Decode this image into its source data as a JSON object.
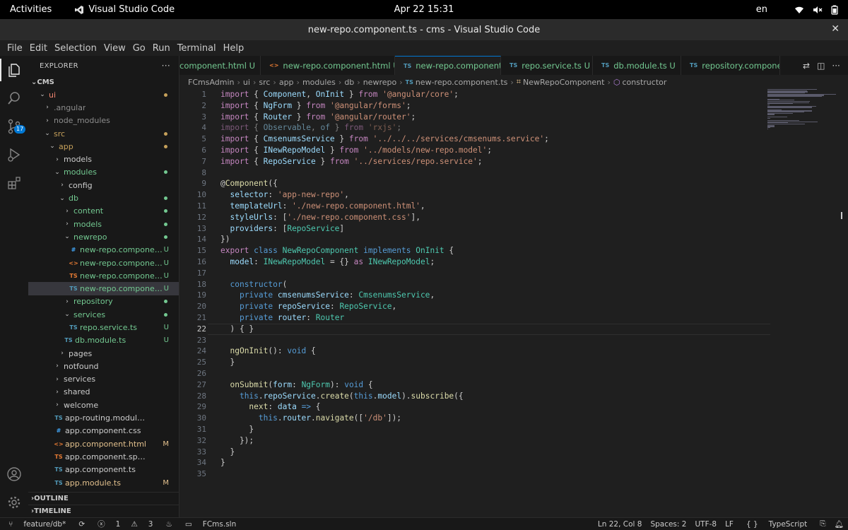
{
  "topbar": {
    "activities": "Activities",
    "app_name": "Visual Studio Code",
    "clock": "Apr 22  15:31",
    "lang": "en"
  },
  "window": {
    "title": "new-repo.component.ts - cms - Visual Studio Code"
  },
  "menu": [
    "File",
    "Edit",
    "Selection",
    "View",
    "Go",
    "Run",
    "Terminal",
    "Help"
  ],
  "activity_bar": {
    "scm_badge": "17"
  },
  "explorer": {
    "header": "EXPLORER",
    "more": "···",
    "root": "CMS",
    "rows": [
      {
        "label": "ui",
        "depth": 1,
        "kind": "folder-open",
        "color": "#f48771",
        "dot": "#c5a05a"
      },
      {
        "label": ".angular",
        "depth": 2,
        "kind": "folder",
        "color": "#8c8c8c"
      },
      {
        "label": "node_modules",
        "depth": 2,
        "kind": "folder",
        "color": "#8c8c8c"
      },
      {
        "label": "src",
        "depth": 2,
        "kind": "folder-open",
        "color": "#c5a05a",
        "dot": "#c5a05a"
      },
      {
        "label": "app",
        "depth": 3,
        "kind": "folder-open",
        "color": "#c5a05a",
        "dot": "#c5a05a"
      },
      {
        "label": "models",
        "depth": 4,
        "kind": "folder",
        "color": "#cccccc"
      },
      {
        "label": "modules",
        "depth": 4,
        "kind": "folder-open",
        "color": "#73c991",
        "dot": "#73c991"
      },
      {
        "label": "config",
        "depth": 5,
        "kind": "folder",
        "color": "#cccccc"
      },
      {
        "label": "db",
        "depth": 5,
        "kind": "folder-open",
        "color": "#73c991",
        "dot": "#73c991"
      },
      {
        "label": "content",
        "depth": 6,
        "kind": "folder",
        "color": "#73c991",
        "dot": "#73c991"
      },
      {
        "label": "models",
        "depth": 6,
        "kind": "folder",
        "color": "#73c991",
        "dot": "#73c991"
      },
      {
        "label": "newrepo",
        "depth": 6,
        "kind": "folder-open",
        "color": "#73c991",
        "dot": "#73c991"
      },
      {
        "label": "new-repo.componen...",
        "depth": 7,
        "kind": "file",
        "icon": "#",
        "icon_color": "#42a5f5",
        "color": "#73c991",
        "status": "U"
      },
      {
        "label": "new-repo.componen...",
        "depth": 7,
        "kind": "file",
        "icon": "<>",
        "icon_color": "#e37933",
        "color": "#73c991",
        "status": "U"
      },
      {
        "label": "new-repo.componen...",
        "depth": 7,
        "kind": "file",
        "icon": "TS",
        "icon_color": "#e37933",
        "color": "#73c991",
        "status": "U"
      },
      {
        "label": "new-repo.componen...",
        "depth": 7,
        "kind": "file",
        "icon": "TS",
        "icon_color": "#519aba",
        "color": "#73c991",
        "status": "U",
        "selected": true
      },
      {
        "label": "repository",
        "depth": 6,
        "kind": "folder",
        "color": "#73c991",
        "dot": "#73c991"
      },
      {
        "label": "services",
        "depth": 6,
        "kind": "folder-open",
        "color": "#73c991",
        "dot": "#73c991"
      },
      {
        "label": "repo.service.ts",
        "depth": 7,
        "kind": "file",
        "icon": "TS",
        "icon_color": "#519aba",
        "color": "#73c991",
        "status": "U"
      },
      {
        "label": "db.module.ts",
        "depth": 6,
        "kind": "file",
        "icon": "TS",
        "icon_color": "#519aba",
        "color": "#73c991",
        "status": "U"
      },
      {
        "label": "pages",
        "depth": 5,
        "kind": "folder",
        "color": "#cccccc"
      },
      {
        "label": "notfound",
        "depth": 4,
        "kind": "folder",
        "color": "#cccccc"
      },
      {
        "label": "services",
        "depth": 4,
        "kind": "folder",
        "color": "#cccccc"
      },
      {
        "label": "shared",
        "depth": 4,
        "kind": "folder",
        "color": "#cccccc"
      },
      {
        "label": "welcome",
        "depth": 4,
        "kind": "folder",
        "color": "#cccccc"
      },
      {
        "label": "app-routing.module.ts",
        "depth": 4,
        "kind": "file",
        "icon": "TS",
        "icon_color": "#519aba",
        "color": "#cccccc"
      },
      {
        "label": "app.component.css",
        "depth": 4,
        "kind": "file",
        "icon": "#",
        "icon_color": "#42a5f5",
        "color": "#cccccc"
      },
      {
        "label": "app.component.html",
        "depth": 4,
        "kind": "file",
        "icon": "<>",
        "icon_color": "#e37933",
        "color": "#e2c08d",
        "status": "M"
      },
      {
        "label": "app.component.spec.ts",
        "depth": 4,
        "kind": "file",
        "icon": "TS",
        "icon_color": "#e37933",
        "color": "#cccccc"
      },
      {
        "label": "app.component.ts",
        "depth": 4,
        "kind": "file",
        "icon": "TS",
        "icon_color": "#519aba",
        "color": "#cccccc"
      },
      {
        "label": "app.module.ts",
        "depth": 4,
        "kind": "file",
        "icon": "TS",
        "icon_color": "#519aba",
        "color": "#e2c08d",
        "status": "M"
      }
    ],
    "outline": "OUTLINE",
    "timeline": "TIMELINE"
  },
  "tabs": [
    {
      "label": "component.html",
      "status": "U",
      "icon": "",
      "icon_color": "#e37933"
    },
    {
      "label": "new-repo.component.html",
      "status": "U",
      "icon": "<>",
      "icon_color": "#e37933"
    },
    {
      "label": "new-repo.component.ts",
      "status": "U",
      "icon": "TS",
      "icon_color": "#519aba",
      "active": true
    },
    {
      "label": "repo.service.ts",
      "status": "U",
      "icon": "TS",
      "icon_color": "#519aba"
    },
    {
      "label": "db.module.ts",
      "status": "U",
      "icon": "TS",
      "icon_color": "#519aba"
    },
    {
      "label": "repository.componen",
      "status": "",
      "icon": "TS",
      "icon_color": "#519aba"
    }
  ],
  "breadcrumb": [
    "FCmsAdmin",
    "ui",
    "src",
    "app",
    "modules",
    "db",
    "newrepo",
    "new-repo.component.ts",
    "NewRepoComponent",
    "constructor"
  ],
  "editor": {
    "current_line": 22,
    "lines": [
      [
        [
          "k",
          "import"
        ],
        [
          "p",
          " { "
        ],
        [
          "v",
          "Component"
        ],
        [
          "p",
          ", "
        ],
        [
          "v",
          "OnInit"
        ],
        [
          "p",
          " } "
        ],
        [
          "k",
          "from"
        ],
        [
          "p",
          " "
        ],
        [
          "s",
          "'@angular/core'"
        ],
        [
          "p",
          ";"
        ]
      ],
      [
        [
          "k",
          "import"
        ],
        [
          "p",
          " { "
        ],
        [
          "v",
          "NgForm"
        ],
        [
          "p",
          " } "
        ],
        [
          "k",
          "from"
        ],
        [
          "p",
          " "
        ],
        [
          "s",
          "'@angular/forms'"
        ],
        [
          "p",
          ";"
        ]
      ],
      [
        [
          "k",
          "import"
        ],
        [
          "p",
          " { "
        ],
        [
          "v",
          "Router"
        ],
        [
          "p",
          " } "
        ],
        [
          "k",
          "from"
        ],
        [
          "p",
          " "
        ],
        [
          "s",
          "'@angular/router'"
        ],
        [
          "p",
          ";"
        ]
      ],
      [
        [
          "dk",
          "import"
        ],
        [
          "dp",
          " { "
        ],
        [
          "dv",
          "Observable"
        ],
        [
          "dp",
          ", "
        ],
        [
          "dv",
          "of"
        ],
        [
          "dp",
          " } "
        ],
        [
          "dk",
          "from"
        ],
        [
          "dp",
          " "
        ],
        [
          "ds",
          "'rxjs'"
        ],
        [
          "dp",
          ";"
        ]
      ],
      [
        [
          "k",
          "import"
        ],
        [
          "p",
          " { "
        ],
        [
          "v",
          "CmsenumsService"
        ],
        [
          "p",
          " } "
        ],
        [
          "k",
          "from"
        ],
        [
          "p",
          " "
        ],
        [
          "s",
          "'../../../services/cmsenums.service'"
        ],
        [
          "p",
          ";"
        ]
      ],
      [
        [
          "k",
          "import"
        ],
        [
          "p",
          " { "
        ],
        [
          "v",
          "INewRepoModel"
        ],
        [
          "p",
          " } "
        ],
        [
          "k",
          "from"
        ],
        [
          "p",
          " "
        ],
        [
          "s",
          "'../models/new-repo.model'"
        ],
        [
          "p",
          ";"
        ]
      ],
      [
        [
          "k",
          "import"
        ],
        [
          "p",
          " { "
        ],
        [
          "v",
          "RepoService"
        ],
        [
          "p",
          " } "
        ],
        [
          "k",
          "from"
        ],
        [
          "p",
          " "
        ],
        [
          "s",
          "'../services/repo.service'"
        ],
        [
          "p",
          ";"
        ]
      ],
      [],
      [
        [
          "p",
          "@"
        ],
        [
          "f",
          "Component"
        ],
        [
          "p",
          "({"
        ]
      ],
      [
        [
          "p",
          "  "
        ],
        [
          "v",
          "selector"
        ],
        [
          "p",
          ": "
        ],
        [
          "s",
          "'app-new-repo'"
        ],
        [
          "p",
          ","
        ]
      ],
      [
        [
          "p",
          "  "
        ],
        [
          "v",
          "templateUrl"
        ],
        [
          "p",
          ": "
        ],
        [
          "s",
          "'./new-repo.component.html'"
        ],
        [
          "p",
          ","
        ]
      ],
      [
        [
          "p",
          "  "
        ],
        [
          "v",
          "styleUrls"
        ],
        [
          "p",
          ": ["
        ],
        [
          "s",
          "'./new-repo.component.css'"
        ],
        [
          "p",
          "],"
        ]
      ],
      [
        [
          "p",
          "  "
        ],
        [
          "v",
          "providers"
        ],
        [
          "p",
          ": ["
        ],
        [
          "t",
          "RepoService"
        ],
        [
          "p",
          "]"
        ]
      ],
      [
        [
          "p",
          "})"
        ]
      ],
      [
        [
          "k",
          "export"
        ],
        [
          "p",
          " "
        ],
        [
          "b",
          "class"
        ],
        [
          "p",
          " "
        ],
        [
          "t",
          "NewRepoComponent"
        ],
        [
          "p",
          " "
        ],
        [
          "b",
          "implements"
        ],
        [
          "p",
          " "
        ],
        [
          "t",
          "OnInit"
        ],
        [
          "p",
          " {"
        ]
      ],
      [
        [
          "p",
          "  "
        ],
        [
          "v",
          "model"
        ],
        [
          "p",
          ": "
        ],
        [
          "t",
          "INewRepoModel"
        ],
        [
          "p",
          " = {} "
        ],
        [
          "k",
          "as"
        ],
        [
          "p",
          " "
        ],
        [
          "t",
          "INewRepoModel"
        ],
        [
          "p",
          ";"
        ]
      ],
      [],
      [
        [
          "p",
          "  "
        ],
        [
          "b",
          "constructor"
        ],
        [
          "p",
          "("
        ]
      ],
      [
        [
          "p",
          "    "
        ],
        [
          "b",
          "private"
        ],
        [
          "p",
          " "
        ],
        [
          "v",
          "cmsenumsService"
        ],
        [
          "p",
          ": "
        ],
        [
          "t",
          "CmsenumsService"
        ],
        [
          "p",
          ","
        ]
      ],
      [
        [
          "p",
          "    "
        ],
        [
          "b",
          "private"
        ],
        [
          "p",
          " "
        ],
        [
          "v",
          "repoService"
        ],
        [
          "p",
          ": "
        ],
        [
          "t",
          "RepoService"
        ],
        [
          "p",
          ","
        ]
      ],
      [
        [
          "p",
          "    "
        ],
        [
          "b",
          "private"
        ],
        [
          "p",
          " "
        ],
        [
          "v",
          "router"
        ],
        [
          "p",
          ": "
        ],
        [
          "t",
          "Router"
        ]
      ],
      [
        [
          "p",
          "  ) { }"
        ]
      ],
      [],
      [
        [
          "p",
          "  "
        ],
        [
          "f",
          "ngOnInit"
        ],
        [
          "p",
          "(): "
        ],
        [
          "b",
          "void"
        ],
        [
          "p",
          " {"
        ]
      ],
      [
        [
          "p",
          "  }"
        ]
      ],
      [],
      [
        [
          "p",
          "  "
        ],
        [
          "f",
          "onSubmit"
        ],
        [
          "p",
          "("
        ],
        [
          "v",
          "form"
        ],
        [
          "p",
          ": "
        ],
        [
          "t",
          "NgForm"
        ],
        [
          "p",
          "): "
        ],
        [
          "b",
          "void"
        ],
        [
          "p",
          " {"
        ]
      ],
      [
        [
          "p",
          "    "
        ],
        [
          "b",
          "this"
        ],
        [
          "p",
          "."
        ],
        [
          "v",
          "repoService"
        ],
        [
          "p",
          "."
        ],
        [
          "f",
          "create"
        ],
        [
          "p",
          "("
        ],
        [
          "b",
          "this"
        ],
        [
          "p",
          "."
        ],
        [
          "v",
          "model"
        ],
        [
          "p",
          ")."
        ],
        [
          "f",
          "subscribe"
        ],
        [
          "p",
          "({"
        ]
      ],
      [
        [
          "p",
          "      "
        ],
        [
          "f",
          "next"
        ],
        [
          "p",
          ": "
        ],
        [
          "v",
          "data"
        ],
        [
          "p",
          " "
        ],
        [
          "b",
          "=>"
        ],
        [
          "p",
          " {"
        ]
      ],
      [
        [
          "p",
          "        "
        ],
        [
          "b",
          "this"
        ],
        [
          "p",
          "."
        ],
        [
          "v",
          "router"
        ],
        [
          "p",
          "."
        ],
        [
          "f",
          "navigate"
        ],
        [
          "p",
          "(["
        ],
        [
          "s",
          "'/db'"
        ],
        [
          "p",
          "]);"
        ]
      ],
      [
        [
          "p",
          "      }"
        ]
      ],
      [
        [
          "p",
          "    });"
        ]
      ],
      [
        [
          "p",
          "  }"
        ]
      ],
      [
        [
          "p",
          "}"
        ]
      ],
      []
    ]
  },
  "status": {
    "branch": "feature/db*",
    "errors": "1",
    "warnings": "3",
    "solution": "FCms.sln",
    "position": "Ln 22, Col 8",
    "spaces": "Spaces: 2",
    "encoding": "UTF-8",
    "eol": "LF",
    "language": "TypeScript"
  },
  "colors": {
    "accent": "#0078d4",
    "untracked": "#73c991",
    "modified": "#e2c08d"
  }
}
